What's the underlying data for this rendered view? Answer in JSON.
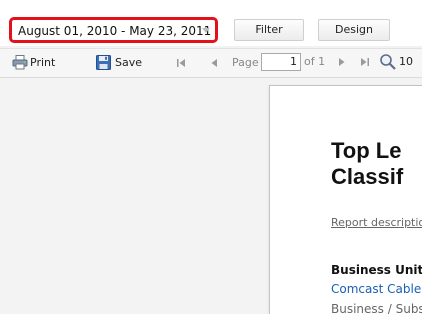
{
  "header": {
    "date_range": "August 01, 2010 - May 23, 2011",
    "filter_label": "Filter",
    "design_label": "Design"
  },
  "toolbar": {
    "print_label": "Print",
    "save_label": "Save",
    "page_label": "Page",
    "page_value": "1",
    "of_label": "of 1",
    "zoom_label": "10",
    "icons": {
      "print": "printer-icon",
      "save": "floppy-disk-icon",
      "first": "first-page-icon",
      "prev": "previous-page-icon",
      "next": "next-page-icon",
      "last": "last-page-icon",
      "zoom": "magnifier-icon"
    }
  },
  "report": {
    "title_line1": "Top Le",
    "title_line2": "Classif",
    "description": "Report descriptio",
    "business_unit_heading": "Business Unit",
    "business_unit_value": "Comcast Cabler",
    "breadcrumb_first": "Business",
    "breadcrumb_sep": " / ",
    "breadcrumb_second": "Subs"
  },
  "colors": {
    "highlight_border": "#e2111a",
    "link_blue": "#1a5fb4"
  }
}
